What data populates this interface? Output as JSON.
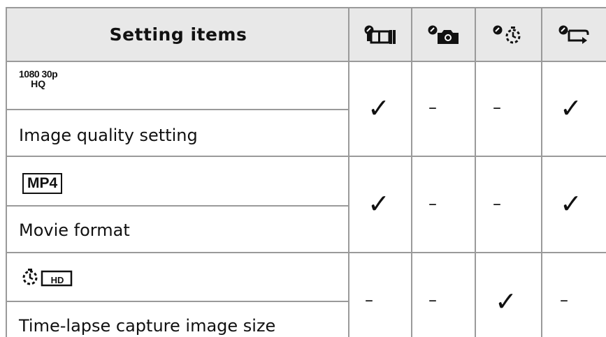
{
  "table": {
    "header": {
      "title": "Setting items",
      "columns": [
        {
          "icon": "movie-mode-icon"
        },
        {
          "icon": "photo-mode-icon"
        },
        {
          "icon": "interval-photo-recording-icon"
        },
        {
          "icon": "loop-recording-icon"
        }
      ]
    },
    "rows": [
      {
        "badge_icon": "1080-30p-hq-icon",
        "badge_top": "1080 30p",
        "badge_bottom": "HQ",
        "label": "Image quality setting",
        "cells": [
          "✓",
          "–",
          "–",
          "✓"
        ]
      },
      {
        "badge_icon": "mp4-icon",
        "badge_text": "MP4",
        "label": "Movie format",
        "cells": [
          "✓",
          "–",
          "–",
          "✓"
        ]
      },
      {
        "badge_icon": "time-lapse-hd-icon",
        "label": "Time-lapse capture image size",
        "cells": [
          "–",
          "–",
          "✓",
          "–"
        ]
      }
    ]
  }
}
